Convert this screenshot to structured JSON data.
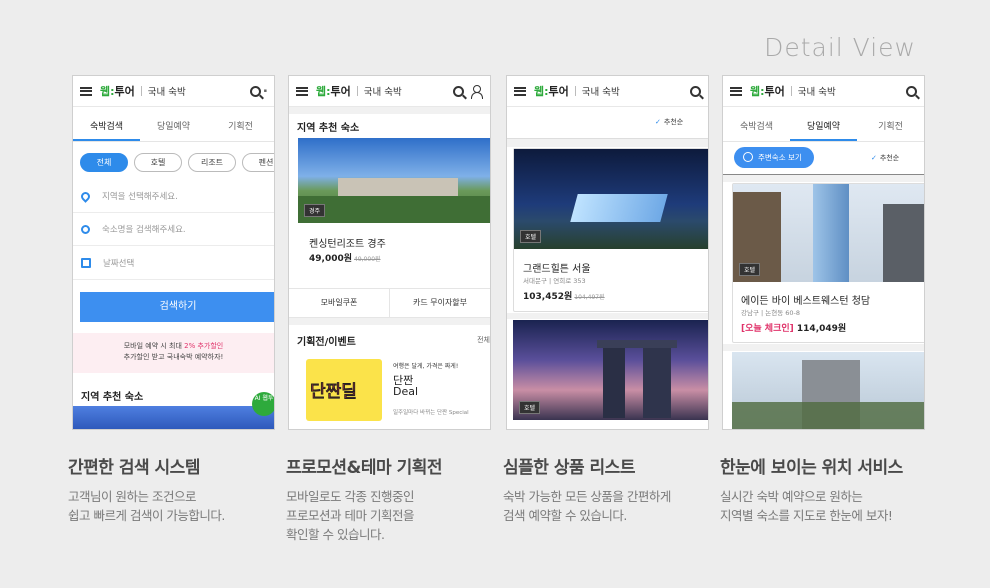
{
  "heading": "Detail View",
  "brand": {
    "logo_a": "웹:",
    "logo_b": "투어",
    "category": "국내 숙박",
    "accent": "#2e8bea",
    "logo_green": "#2eaa3c"
  },
  "panel1": {
    "tabs": [
      "숙박검색",
      "당일예약",
      "기획전"
    ],
    "chips": [
      "전체",
      "호텔",
      "리조트",
      "펜션"
    ],
    "fields": [
      "지역을 선택해주세요.",
      "숙소명을 검색해주세요.",
      "날짜선택"
    ],
    "search_button": "검색하기",
    "promo_line1_a": "모바일 예약 시 최대 ",
    "promo_line1_b": "2% 추가할인",
    "promo_line2": "추가할인 받고 국내숙박 예약하자!",
    "section": "지역 추천 숙소",
    "ai_badge": "AI 웹투"
  },
  "panel2": {
    "section": "지역 추천 숙소",
    "tag": "경주",
    "hotel": "켄싱턴리조트 경주",
    "price": "49,000원",
    "old_price": "49,000원",
    "buttons": [
      "모바일쿠폰",
      "카드 무이자할부"
    ],
    "section2": "기획전/이벤트",
    "more": "전체",
    "deal_word": "단짠딜",
    "deal_line1": "여행은 달게, 가격은 짜게!",
    "deal_title1": "단짠",
    "deal_title2": "Deal",
    "deal_line2": "일주일마다 바뀌는 단짠 Special"
  },
  "panel3": {
    "sort": "추천순",
    "tag1": "호텔",
    "hotel": "그랜드힐튼 서울",
    "addr": "서대문구 | 연희로 353",
    "price": "103,452원",
    "old_price": "104,497원",
    "tag2": "호텔"
  },
  "panel4": {
    "tabs": [
      "숙박검색",
      "당일예약",
      "기획전"
    ],
    "map_button": "주변숙소 보기",
    "sort": "추천순",
    "tag": "호텔",
    "hotel": "에이든 바이 베스트웨스턴 청담",
    "addr": "강남구 | 논현동 60-8",
    "today": "[오늘 체크인]",
    "price": "114,049원"
  },
  "captions": [
    {
      "title": "간편한 검색 시스템",
      "text": "고객님이 원하는 조건으로\n쉽고 빠르게 검색이 가능합니다."
    },
    {
      "title": "프로모션&테마 기획전",
      "text": "모바일로도 각종 진행중인\n프로모션과 테마 기획전을\n확인할 수 있습니다."
    },
    {
      "title": "심플한 상품 리스트",
      "text": "숙박 가능한 모든 상품을 간편하게\n검색 예약할 수 있습니다."
    },
    {
      "title": "한눈에 보이는 위치 서비스",
      "text": "실시간 숙박 예약으로 원하는\n지역별 숙소를 지도로 한눈에 보자!"
    }
  ]
}
